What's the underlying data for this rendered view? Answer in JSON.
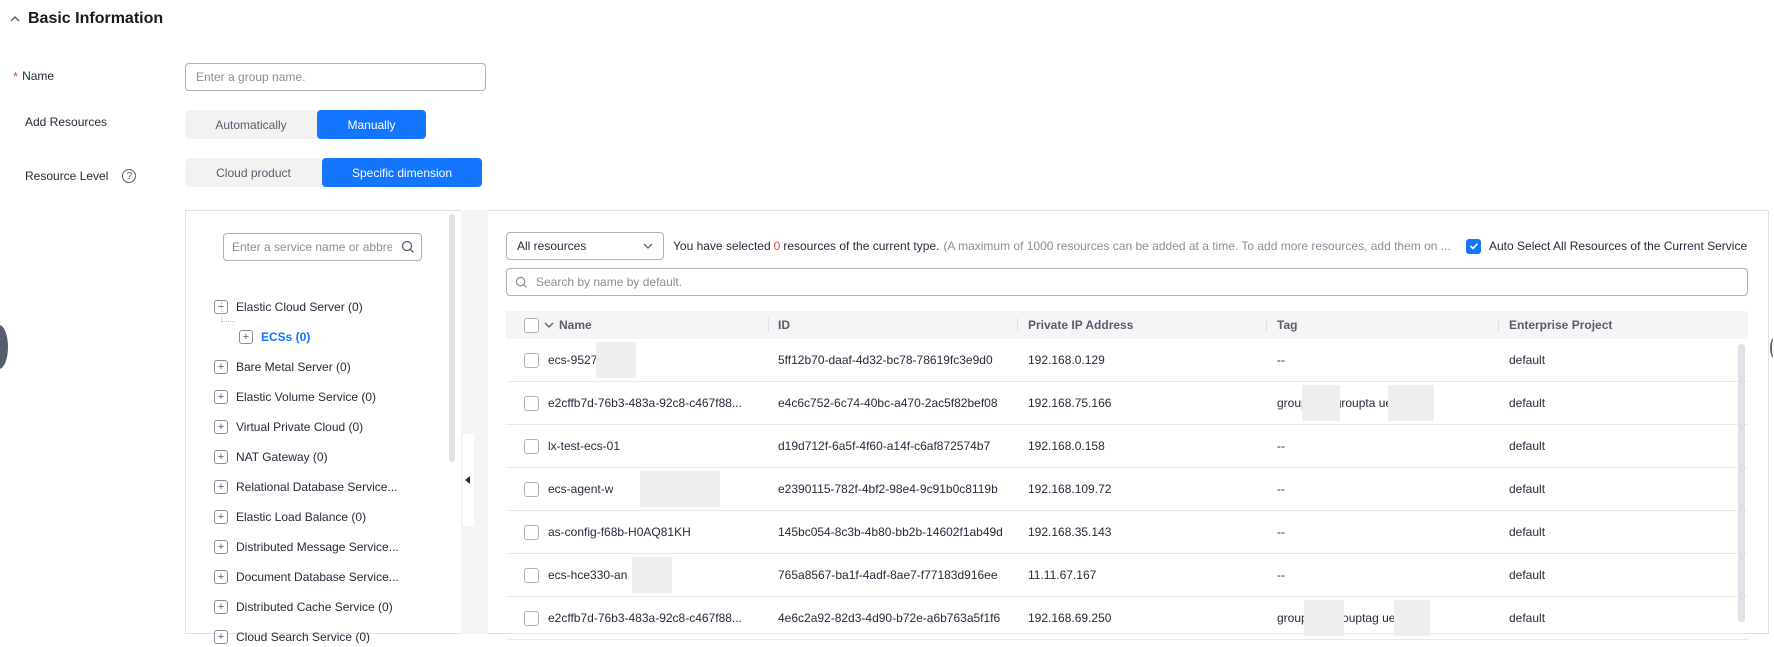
{
  "section": {
    "title": "Basic Information"
  },
  "form": {
    "name_label": "Name",
    "name_placeholder": "Enter a group name.",
    "add_resources_label": "Add Resources",
    "add_resources_options": [
      "Automatically",
      "Manually"
    ],
    "add_resources_selected": "Manually",
    "resource_level_label": "Resource Level",
    "resource_level_options": [
      "Cloud product",
      "Specific dimension"
    ],
    "resource_level_selected": "Specific dimension"
  },
  "tree": {
    "search_placeholder": "Enter a service name or abbreviation",
    "items": [
      {
        "label": "Elastic Cloud Server (0)",
        "expanded": true
      },
      {
        "label": "ECSs (0)",
        "child": true
      },
      {
        "label": "Bare Metal Server (0)"
      },
      {
        "label": "Elastic Volume Service (0)"
      },
      {
        "label": "Virtual Private Cloud (0)"
      },
      {
        "label": "NAT Gateway (0)"
      },
      {
        "label": "Relational Database Service..."
      },
      {
        "label": "Elastic Load Balance (0)"
      },
      {
        "label": "Distributed Message Service..."
      },
      {
        "label": "Document Database Service..."
      },
      {
        "label": "Distributed Cache Service (0)"
      },
      {
        "label": "Cloud Search Service (0)"
      }
    ]
  },
  "resources": {
    "filter_selected": "All resources",
    "hint_prefix": "You have selected",
    "hint_count": "0",
    "hint_suffix": "resources of the current type.",
    "hint_note": "(A maximum of 1000 resources can be added at a time. To add more resources, add them on ...",
    "auto_select_label": "Auto Select All Resources of the Current Service",
    "auto_select_checked": true,
    "search_placeholder": "Search by name by default.",
    "columns": [
      "Name",
      "ID",
      "Private IP Address",
      "Tag",
      "Enterprise Project"
    ],
    "rows": [
      {
        "name": "ecs-9527",
        "id": "5ff12b70-daaf-4d32-bc78-78619fc3e9d0",
        "ip": "192.168.0.129",
        "tag": "--",
        "project": "default"
      },
      {
        "name": "e2cffb7d-76b3-483a-92c8-c467f88...",
        "id": "e4c6c752-6c74-40bc-a470-2ac5f82bef08",
        "ip": "192.168.75.166",
        "tag": "groupt 2 = groupta ue2...",
        "project": "default"
      },
      {
        "name": "lx-test-ecs-01",
        "id": "d19d712f-6a5f-4f60-a14f-c6af872574b7",
        "ip": "192.168.0.158",
        "tag": "--",
        "project": "default"
      },
      {
        "name": "ecs-agent-w",
        "id": "e2390115-782f-4bf2-98e4-9c91b0c8119b",
        "ip": "192.168.109.72",
        "tag": "--",
        "project": "default"
      },
      {
        "name": "as-config-f68b-H0AQ81KH",
        "id": "145bc054-8c3b-4b80-bb2b-14602f1ab49d",
        "ip": "192.168.35.143",
        "tag": "--",
        "project": "default"
      },
      {
        "name": "ecs-hce330-an",
        "id": "765a8567-ba1f-4adf-8ae7-f77183d916ee",
        "ip": "11.11.67.167",
        "tag": "--",
        "project": "default"
      },
      {
        "name": "e2cffb7d-76b3-483a-92c8-c467f88...",
        "id": "4e6c2a92-82d3-4d90-b72e-a6b763a5f1f6",
        "ip": "192.168.69.250",
        "tag": "groupta = grouptag ue2",
        "project": "default"
      }
    ]
  },
  "colors": {
    "primary": "#1476ff",
    "danger": "#e6463c"
  },
  "icons": [
    "chevron-up-icon",
    "help-icon",
    "thumbs-up-icon",
    "search-icon",
    "collapse-left-icon",
    "chevron-down-icon",
    "check-icon"
  ]
}
